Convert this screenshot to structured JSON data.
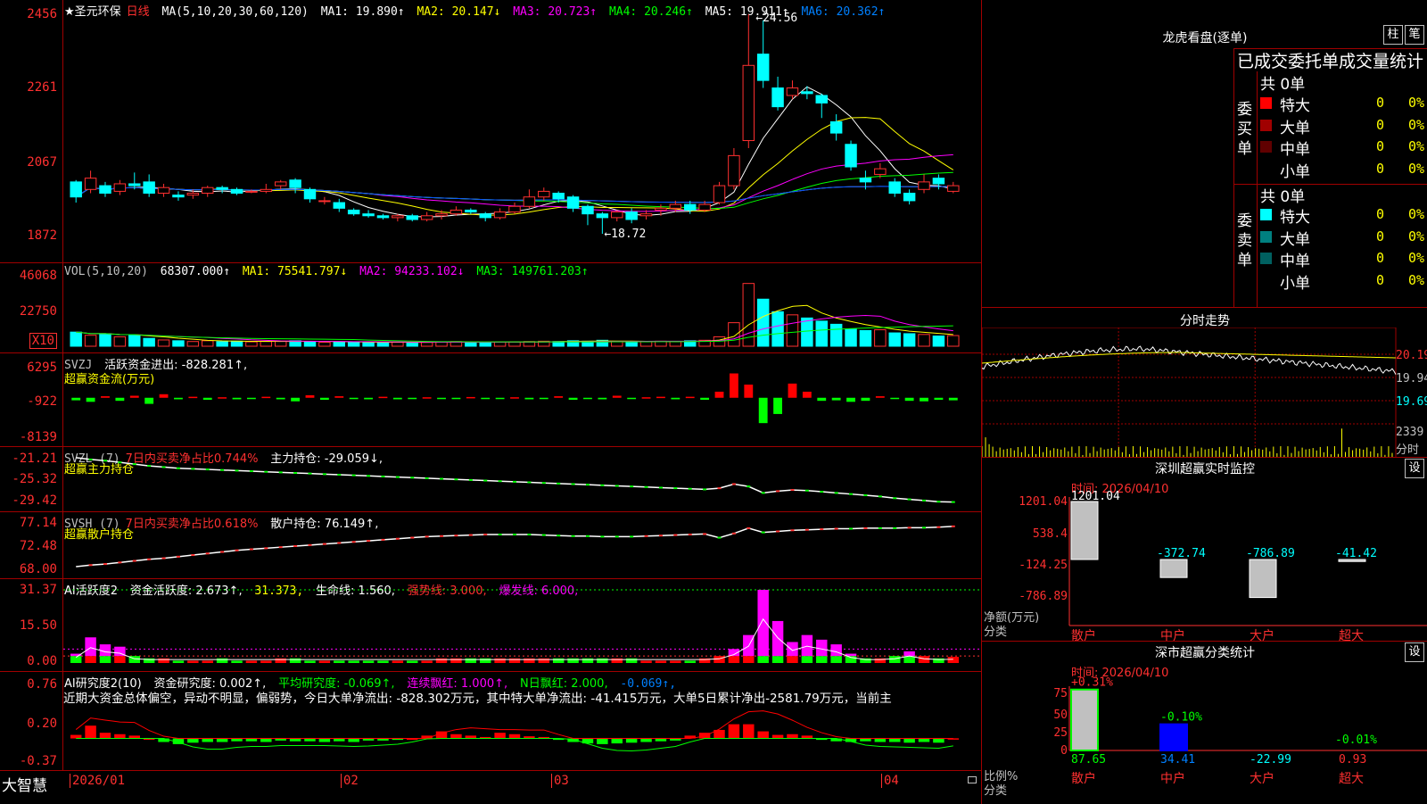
{
  "app": {
    "brand": "大智慧",
    "stock_name": "★圣元环保",
    "period": "日线"
  },
  "main_pane": {
    "ma_label": "MA(5,10,20,30,60,120)",
    "ma1": "MA1: 19.890↑",
    "ma2": "MA2: 20.147↓",
    "ma3": "MA3: 20.723↑",
    "ma4": "MA4: 20.246↑",
    "ma5": "MA5: 19.911↑",
    "ma6": "MA6: 20.362↑",
    "ticks": [
      "2456",
      "2261",
      "2067",
      "1872"
    ],
    "high_label": "24.56",
    "low_label": "18.72"
  },
  "vol_pane": {
    "header": "VOL(5,10,20)",
    "value": "68307.000↑",
    "ma1": "MA1: 75541.797↓",
    "ma2": "MA2: 94233.102↓",
    "ma3": "MA3: 149761.203↑",
    "ticks": [
      "46068",
      "22750"
    ],
    "unit": "X10"
  },
  "svzj_pane": {
    "name": "SVZJ",
    "label": "活跃资金进出: -828.281↑,",
    "subtitle": "超赢资金流(万元)",
    "ticks": [
      "6295",
      "-922",
      "-8139"
    ]
  },
  "svzl_pane": {
    "name": "SVZL (7)",
    "label1": "7日内买卖净占比0.744%",
    "label2": "主力持仓: -29.059↓,",
    "subtitle": "超赢主力持仓",
    "ticks": [
      "-21.21",
      "-25.32",
      "-29.42"
    ]
  },
  "svsh_pane": {
    "name": "SVSH (7)",
    "label1": "7日内买卖净占比0.618%",
    "label2": "散户持仓: 76.149↑,",
    "subtitle": "超赢散户持仓",
    "ticks": [
      "77.14",
      "72.48",
      "68.00"
    ]
  },
  "ai_active_pane": {
    "name": "AI活跃度2",
    "label1": "资金活跃度: 2.673↑,",
    "label2": "31.373,",
    "label3": "生命线: 1.560,",
    "label4": "强势线: 3.000,",
    "label5": "爆发线: 6.000,",
    "ticks": [
      "31.37",
      "15.50",
      "0.00"
    ]
  },
  "ai_research_pane": {
    "name": "AI研究度2(10)",
    "label1": "资金研究度: 0.002↑,",
    "label2": "平均研究度: -0.069↑,",
    "label3": "连续飘红: 1.000↑,",
    "label4": "N日飘红: 2.000,",
    "label5": "-0.069↑,",
    "text": "近期大资金总体偏空，异动不明显，偏弱势，今日大单净流出: -828.302万元，其中特大单净流出: -41.415万元，大单5日累计净出-2581.79万元，当前主",
    "ticks": [
      "0.76",
      "0.20",
      "-0.37"
    ]
  },
  "date_axis": [
    "2026/01",
    "02",
    "03",
    "04"
  ],
  "dragon_tiger": {
    "title": "龙虎看盘(逐单)",
    "btn_bar": "柱",
    "btn_pen": "笔",
    "header": "已成交委托单成交量统计",
    "buy_label": "委买单",
    "sell_label": "委卖单",
    "buy_total": "共 0单",
    "sell_total": "共 0单",
    "buy_rows": [
      {
        "name": "特大",
        "count": "0",
        "pct": "0%",
        "color": "#ff0000"
      },
      {
        "name": "大单",
        "count": "0",
        "pct": "0%",
        "color": "#a00000"
      },
      {
        "name": "中单",
        "count": "0",
        "pct": "0%",
        "color": "#600000"
      },
      {
        "name": "小单",
        "count": "0",
        "pct": "0%",
        "color": "#000000"
      }
    ],
    "sell_rows": [
      {
        "name": "特大",
        "count": "0",
        "pct": "0%",
        "color": "#00ffff"
      },
      {
        "name": "大单",
        "count": "0",
        "pct": "0%",
        "color": "#008080"
      },
      {
        "name": "中单",
        "count": "0",
        "pct": "0%",
        "color": "#006060"
      },
      {
        "name": "小单",
        "count": "0",
        "pct": "0%",
        "color": "#000000"
      }
    ]
  },
  "intraday": {
    "title": "分时走势",
    "price_ticks": [
      "20.19",
      "19.94",
      "19.69"
    ],
    "vol_tick": "2339",
    "vol_unit": "分时"
  },
  "sz_monitor": {
    "title": "深圳超赢实时监控",
    "btn": "设",
    "time": "时间: 2026/04/10",
    "ticks": [
      "1201.04",
      "538.4",
      "-124.25",
      "-786.89"
    ],
    "ylabel": "净额(万元)",
    "xlabel": "分类",
    "categories": [
      "散户",
      "中户",
      "大户",
      "超大"
    ]
  },
  "sz_stats": {
    "title": "深市超赢分类统计",
    "btn": "设",
    "time": "时间: 2026/04/10",
    "ticks": [
      "75",
      "50",
      "25",
      "0"
    ],
    "ylabel": "比例%",
    "xlabel": "分类",
    "categories": [
      "散户",
      "中户",
      "大户",
      "超大"
    ]
  },
  "chart_data": [
    {
      "type": "candlestick",
      "title": "",
      "ylim": [
        18.72,
        24.56
      ],
      "candles": [
        [
          20.1,
          19.7,
          20.15,
          19.55
        ],
        [
          19.9,
          20.2,
          20.4,
          19.8
        ],
        [
          20.0,
          19.8,
          20.1,
          19.7
        ],
        [
          19.85,
          20.05,
          20.15,
          19.75
        ],
        [
          20.05,
          20.0,
          20.35,
          19.9
        ],
        [
          20.1,
          19.8,
          20.3,
          19.7
        ],
        [
          19.8,
          19.95,
          20.05,
          19.7
        ],
        [
          19.75,
          19.7,
          19.85,
          19.6
        ],
        [
          19.75,
          19.8,
          19.9,
          19.65
        ],
        [
          19.8,
          19.95,
          20.0,
          19.7
        ],
        [
          19.95,
          19.9,
          20.0,
          19.8
        ],
        [
          19.9,
          19.8,
          19.95,
          19.75
        ],
        [
          19.85,
          19.85,
          19.9,
          19.8
        ],
        [
          19.85,
          19.9,
          20.05,
          19.8
        ],
        [
          20.0,
          20.1,
          20.15,
          19.9
        ],
        [
          20.15,
          19.95,
          20.2,
          19.8
        ],
        [
          19.9,
          19.65,
          19.95,
          19.55
        ],
        [
          19.6,
          19.6,
          19.7,
          19.5
        ],
        [
          19.55,
          19.4,
          19.65,
          19.3
        ],
        [
          19.35,
          19.25,
          19.4,
          19.2
        ],
        [
          19.25,
          19.2,
          19.35,
          19.15
        ],
        [
          19.2,
          19.15,
          19.25,
          19.1
        ],
        [
          19.15,
          19.2,
          19.25,
          19.05
        ],
        [
          19.2,
          19.1,
          19.25,
          19.05
        ],
        [
          19.1,
          19.2,
          19.3,
          19.05
        ],
        [
          19.2,
          19.25,
          19.35,
          19.1
        ],
        [
          19.25,
          19.35,
          19.45,
          19.2
        ],
        [
          19.35,
          19.3,
          19.4,
          19.25
        ],
        [
          19.25,
          19.15,
          19.3,
          19.05
        ],
        [
          19.15,
          19.3,
          19.4,
          19.1
        ],
        [
          19.3,
          19.45,
          19.55,
          19.25
        ],
        [
          19.45,
          19.7,
          19.9,
          19.4
        ],
        [
          19.7,
          19.85,
          19.95,
          19.6
        ],
        [
          19.8,
          19.65,
          19.85,
          19.55
        ],
        [
          19.7,
          19.4,
          19.75,
          19.3
        ],
        [
          19.45,
          19.25,
          19.5,
          18.95
        ],
        [
          19.25,
          19.15,
          19.3,
          18.72
        ],
        [
          19.15,
          19.3,
          19.35,
          19.05
        ],
        [
          19.3,
          19.1,
          19.4,
          19.0
        ],
        [
          19.2,
          19.25,
          19.35,
          19.1
        ],
        [
          19.35,
          19.4,
          19.5,
          19.2
        ],
        [
          19.4,
          19.5,
          19.6,
          19.3
        ],
        [
          19.5,
          19.35,
          19.6,
          19.25
        ],
        [
          19.35,
          19.5,
          19.6,
          19.3
        ],
        [
          19.55,
          20.0,
          20.1,
          19.5
        ],
        [
          20.0,
          20.8,
          21.0,
          19.9
        ],
        [
          21.2,
          23.2,
          24.56,
          21.0
        ],
        [
          23.5,
          22.8,
          24.4,
          22.6
        ],
        [
          22.6,
          22.1,
          22.9,
          22.0
        ],
        [
          22.4,
          22.6,
          22.8,
          22.3
        ],
        [
          22.5,
          22.45,
          22.65,
          22.3
        ],
        [
          22.4,
          22.2,
          22.45,
          21.8
        ],
        [
          21.7,
          21.4,
          21.9,
          21.2
        ],
        [
          21.1,
          20.5,
          21.2,
          20.4
        ],
        [
          20.2,
          20.1,
          20.4,
          19.9
        ],
        [
          20.3,
          20.45,
          20.6,
          20.2
        ],
        [
          20.1,
          19.8,
          20.2,
          19.7
        ],
        [
          19.8,
          19.6,
          19.9,
          19.5
        ],
        [
          19.9,
          20.1,
          20.3,
          19.8
        ],
        [
          20.2,
          20.05,
          20.3,
          19.9
        ],
        [
          19.85,
          20.0,
          20.1,
          19.8
        ]
      ]
    },
    {
      "type": "bar",
      "title": "VOL(5,10,20)",
      "ylim": [
        0,
        46068
      ],
      "values": [
        9000,
        7000,
        8000,
        6000,
        7000,
        5000,
        4000,
        3500,
        3000,
        3500,
        3000,
        3200,
        2800,
        3000,
        3200,
        3500,
        3000,
        2500,
        2800,
        2500,
        2400,
        2600,
        2500,
        2300,
        2500,
        2800,
        3000,
        2600,
        2400,
        2600,
        2800,
        3000,
        3200,
        3000,
        3500,
        3200,
        3800,
        3000,
        2800,
        3000,
        3200,
        3000,
        3500,
        3800,
        6000,
        15000,
        40000,
        30000,
        22000,
        20000,
        18000,
        16000,
        14000,
        11000,
        10000,
        10500,
        8500,
        8000,
        7500,
        6500,
        6800
      ]
    },
    {
      "type": "bar",
      "title": "超赢资金流(万元)",
      "ylim": [
        -8139,
        6295
      ],
      "values": [
        -500,
        -800,
        300,
        -600,
        400,
        -1200,
        700,
        -300,
        200,
        -400,
        100,
        -300,
        -200,
        200,
        -300,
        -700,
        500,
        -400,
        300,
        -200,
        -300,
        200,
        -300,
        -200,
        100,
        -200,
        -100,
        150,
        -200,
        -150,
        100,
        -300,
        -200,
        300,
        -400,
        -200,
        -300,
        400,
        -200,
        100,
        200,
        -300,
        200,
        -400,
        1200,
        4800,
        2600,
        -5000,
        -3200,
        2800,
        1200,
        -600,
        -500,
        -800,
        -600,
        300,
        -200,
        -600,
        -700,
        -400,
        -500
      ]
    },
    {
      "type": "line",
      "title": "超赢主力持仓",
      "ylim": [
        -29.42,
        -21.21
      ],
      "values": [
        -21.5,
        -21.8,
        -22.0,
        -22.3,
        -22.6,
        -22.9,
        -23.1,
        -23.3,
        -23.4,
        -23.5,
        -23.6,
        -23.7,
        -23.8,
        -23.9,
        -24.0,
        -24.1,
        -24.2,
        -24.3,
        -24.4,
        -24.5,
        -24.6,
        -24.7,
        -24.8,
        -24.9,
        -25.0,
        -25.1,
        -25.2,
        -25.3,
        -25.4,
        -25.5,
        -25.6,
        -25.7,
        -25.8,
        -25.9,
        -26.0,
        -26.1,
        -26.2,
        -26.3,
        -26.4,
        -26.5,
        -26.6,
        -26.7,
        -26.8,
        -26.9,
        -26.7,
        -26.0,
        -26.4,
        -27.5,
        -27.2,
        -27.0,
        -27.1,
        -27.3,
        -27.5,
        -27.7,
        -27.9,
        -28.1,
        -28.4,
        -28.6,
        -28.8,
        -29.0,
        -29.06
      ]
    },
    {
      "type": "line",
      "title": "超赢散户持仓",
      "ylim": [
        68.0,
        77.14
      ],
      "values": [
        68.5,
        68.8,
        69.0,
        69.3,
        69.6,
        69.9,
        70.1,
        70.4,
        70.7,
        71.0,
        71.3,
        71.6,
        71.8,
        72.0,
        72.2,
        72.4,
        72.6,
        72.8,
        73.0,
        73.2,
        73.4,
        73.6,
        73.8,
        74.0,
        74.2,
        74.3,
        74.4,
        74.5,
        74.6,
        74.6,
        74.6,
        74.6,
        74.5,
        74.4,
        74.3,
        74.3,
        74.2,
        74.2,
        74.2,
        74.3,
        74.4,
        74.5,
        74.6,
        74.7,
        74.0,
        74.8,
        75.8,
        75.0,
        75.2,
        75.4,
        75.5,
        75.6,
        75.7,
        75.7,
        75.8,
        75.8,
        75.8,
        75.9,
        75.9,
        76.0,
        76.15
      ]
    },
    {
      "type": "bar",
      "title": "AI活跃度2",
      "ylim": [
        0,
        31.37
      ],
      "values": [
        4,
        11,
        8,
        7,
        3,
        2,
        2,
        1,
        1,
        1,
        2,
        1,
        1,
        1,
        2,
        2,
        1,
        1,
        1,
        1,
        1,
        1,
        1,
        1,
        1,
        2,
        2,
        2,
        2,
        2,
        2,
        2,
        2,
        2,
        2,
        2,
        2,
        2,
        2,
        1,
        1,
        1,
        1,
        2,
        3,
        6,
        12,
        31.37,
        18,
        9,
        12,
        10,
        8,
        4,
        2,
        2,
        3,
        5,
        3,
        2,
        2.67
      ]
    },
    {
      "type": "bar",
      "title": "AI研究度2(10)",
      "ylim": [
        -0.37,
        0.76
      ],
      "values": [
        0.05,
        0.18,
        0.08,
        0.06,
        0.04,
        0.0,
        -0.05,
        -0.08,
        -0.06,
        -0.05,
        -0.05,
        -0.04,
        -0.04,
        -0.05,
        -0.03,
        -0.04,
        -0.04,
        -0.05,
        -0.04,
        -0.05,
        -0.03,
        -0.03,
        -0.02,
        0.0,
        0.04,
        0.1,
        0.06,
        0.04,
        0.02,
        0.08,
        0.06,
        0.03,
        0.02,
        -0.02,
        -0.05,
        -0.07,
        -0.08,
        -0.07,
        -0.06,
        -0.05,
        -0.04,
        -0.03,
        0.04,
        0.08,
        0.12,
        0.2,
        0.2,
        0.1,
        0.05,
        0.06,
        0.04,
        -0.02,
        -0.04,
        -0.05,
        -0.04,
        -0.05,
        -0.05,
        -0.06,
        -0.05,
        -0.06,
        0.002
      ]
    }
  ]
}
